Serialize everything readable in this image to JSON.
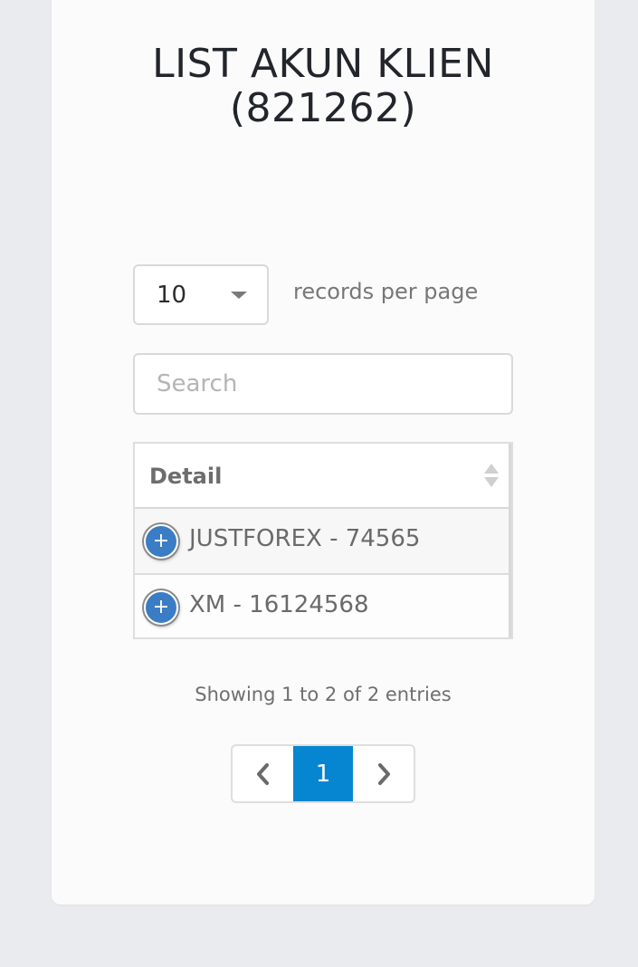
{
  "page": {
    "title_line1": "LIST AKUN KLIEN",
    "title_line2": "(821262)"
  },
  "length_menu": {
    "selected": "10",
    "label": "records per page"
  },
  "search": {
    "placeholder": "Search",
    "value": ""
  },
  "table": {
    "column_header": "Detail",
    "rows": [
      {
        "expand_symbol": "+",
        "text": "JUSTFOREX - 74565"
      },
      {
        "expand_symbol": "+",
        "text": "XM - 16124568"
      }
    ]
  },
  "info_text": "Showing 1 to 2 of 2 entries",
  "pagination": {
    "current_page": "1",
    "prev_icon": "chevron-left-icon",
    "next_icon": "chevron-right-icon"
  },
  "colors": {
    "accent": "#0686d0",
    "expand_button": "#3b7dc4",
    "background": "#eaebee",
    "card": "#fbfbfb"
  }
}
